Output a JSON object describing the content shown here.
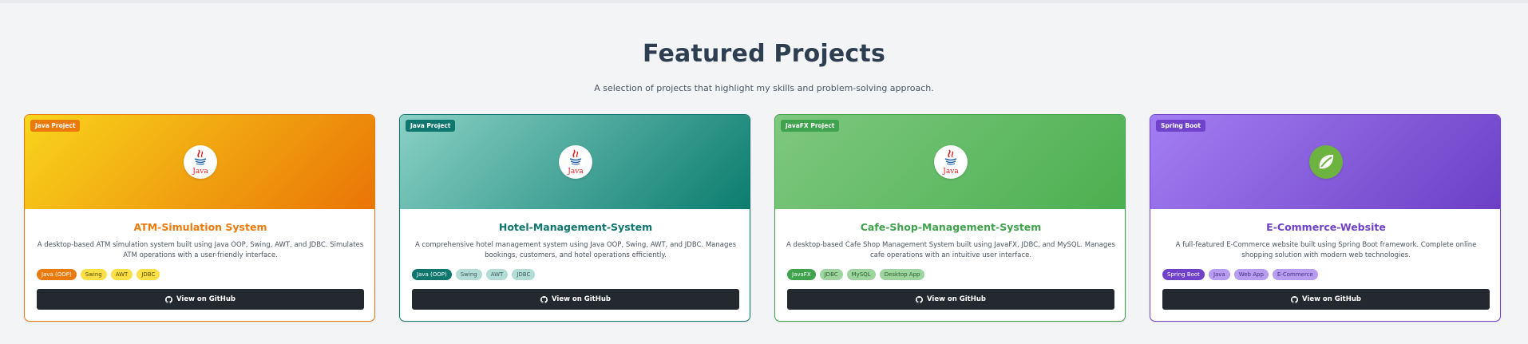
{
  "section": {
    "title": "Featured Projects",
    "subtitle": "A selection of projects that highlight my skills and problem-solving approach."
  },
  "projects": [
    {
      "badge": "Java Project",
      "logo": "java-logo",
      "logo_text": "Java",
      "title": "ATM-Simulation System",
      "description": "A desktop-based ATM simulation system built using Java OOP, Swing, AWT, and JDBC. Simulates ATM operations with a user-friendly interface.",
      "tags": [
        "Java (OOP)",
        "Swing",
        "AWT",
        "JDBC"
      ],
      "button": "View on GitHub",
      "accent": "#ea7a0c",
      "gradient": [
        "#f8d51c",
        "#e97406"
      ],
      "tag_bg": "#fde047",
      "tag_text": "#5b4a05"
    },
    {
      "badge": "Java Project",
      "logo": "java-logo",
      "logo_text": "Java",
      "title": "Hotel-Management-System",
      "description": "A comprehensive hotel management system using Java OOP, Swing, AWT, and JDBC. Manages bookings, customers, and hotel operations efficiently.",
      "tags": [
        "Java (OOP)",
        "Swing",
        "AWT",
        "JDBC"
      ],
      "button": "View on GitHub",
      "accent": "#0f766e",
      "gradient": [
        "#8ad0c5",
        "#0b7d6f"
      ],
      "tag_bg": "#b2dcd6",
      "tag_text": "#3c5c57"
    },
    {
      "badge": "JavaFX Project",
      "logo": "java-logo",
      "logo_text": "Java",
      "title": "Cafe-Shop-Management-System",
      "description": "A desktop-based Cafe Shop Management System built using JavaFX, JDBC, and MySQL. Manages cafe operations with an intuitive user interface.",
      "tags": [
        "JavaFX",
        "JDBC",
        "MySQL",
        "Desktop App"
      ],
      "button": "View on GitHub",
      "accent": "#3fa34d",
      "gradient": [
        "#7ec87f",
        "#4caf50"
      ],
      "tag_bg": "#9ed49e",
      "tag_text": "#2f5d31"
    },
    {
      "badge": "Spring Boot",
      "logo": "spring-leaf-logo",
      "logo_text": "",
      "title": "E-Commerce-Website",
      "description": "A full-featured E-Commerce website built using Spring Boot framework. Complete online shopping solution with modern web technologies.",
      "tags": [
        "Spring Boot",
        "Java",
        "Web App",
        "E-Commerce"
      ],
      "button": "View on GitHub",
      "accent": "#7042c9",
      "gradient": [
        "#a37ef3",
        "#6c3fc4"
      ],
      "tag_bg": "#b79cf0",
      "tag_text": "#4a2e8a"
    }
  ]
}
